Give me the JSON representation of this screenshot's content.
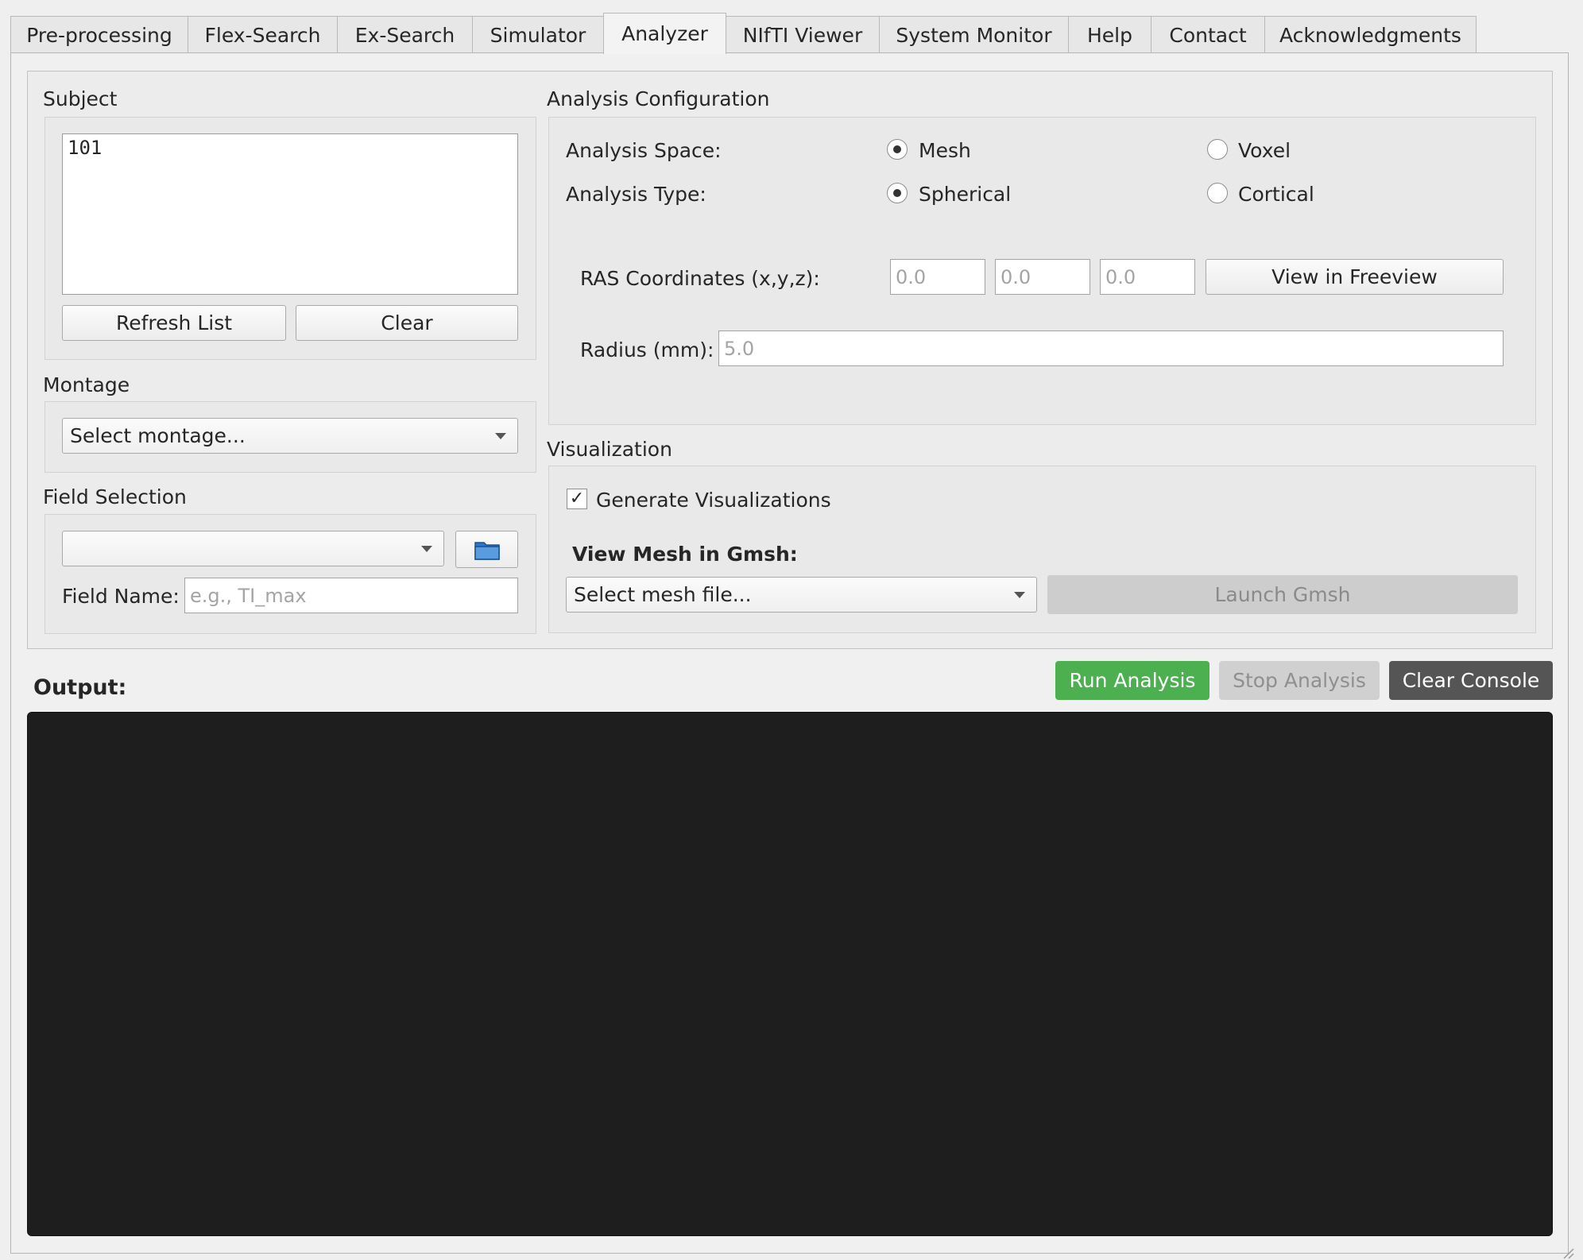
{
  "tabs": [
    "Pre-processing",
    "Flex-Search",
    "Ex-Search",
    "Simulator",
    "Analyzer",
    "NIfTI Viewer",
    "System Monitor",
    "Help",
    "Contact",
    "Acknowledgments"
  ],
  "active_tab": "Analyzer",
  "subject": {
    "title": "Subject",
    "items": [
      "101"
    ],
    "refresh_label": "Refresh List",
    "clear_label": "Clear"
  },
  "montage": {
    "title": "Montage",
    "selected": "Select montage..."
  },
  "field_selection": {
    "title": "Field Selection",
    "selected": "",
    "browse_icon": "folder-icon",
    "field_name_label": "Field Name:",
    "field_name_value": "",
    "field_name_placeholder": "e.g., TI_max"
  },
  "analysis_config": {
    "title": "Analysis Configuration",
    "space_label": "Analysis Space:",
    "space_options": [
      "Mesh",
      "Voxel"
    ],
    "space_selected": "Mesh",
    "type_label": "Analysis Type:",
    "type_options": [
      "Spherical",
      "Cortical"
    ],
    "type_selected": "Spherical",
    "ras_label": "RAS Coordinates (x,y,z):",
    "ras_placeholders": [
      "0.0",
      "0.0",
      "0.0"
    ],
    "freeview_label": "View in Freeview",
    "radius_label": "Radius (mm):",
    "radius_placeholder": "5.0"
  },
  "visualization": {
    "title": "Visualization",
    "generate_label": "Generate Visualizations",
    "generate_checked": true,
    "gmsh_title": "View Mesh in Gmsh:",
    "mesh_selected": "Select mesh file...",
    "launch_label": "Launch Gmsh"
  },
  "output": {
    "title": "Output:",
    "run_label": "Run Analysis",
    "stop_label": "Stop Analysis",
    "clear_console_label": "Clear Console",
    "console_text": ""
  },
  "colors": {
    "run_button": "#4caf50",
    "stop_button_disabled": "#d0d0d0",
    "clear_console_button": "#555555",
    "console_background": "#1e1e1e"
  }
}
